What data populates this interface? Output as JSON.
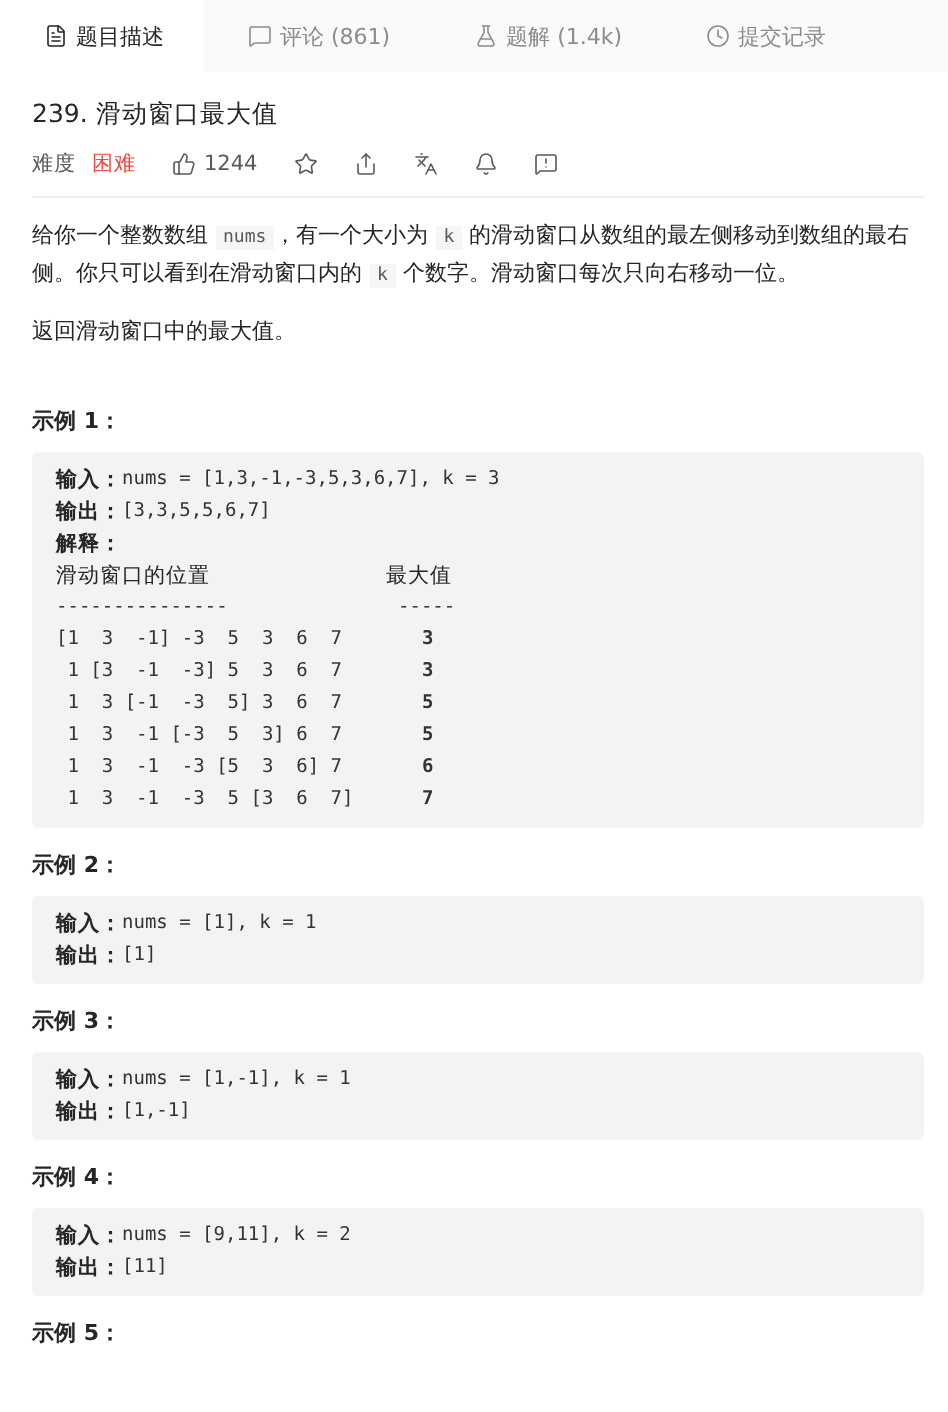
{
  "tabs": [
    {
      "kind": "description",
      "label": "题目描述",
      "selected": true
    },
    {
      "kind": "comments",
      "label": "评论 (861)",
      "selected": false
    },
    {
      "kind": "solutions",
      "label": "题解 (1.4k)",
      "selected": false
    },
    {
      "kind": "submissions",
      "label": "提交记录",
      "selected": false
    }
  ],
  "problem": {
    "title": "239. 滑动窗口最大值",
    "difficulty_label": "难度",
    "difficulty": "困难",
    "likes": "1244"
  },
  "description": [
    [
      {
        "kind": "text",
        "text": "给你一个整数数组 "
      },
      {
        "kind": "code",
        "text": "nums"
      },
      {
        "kind": "text",
        "text": "，有一个大小为 "
      },
      {
        "kind": "code",
        "text": "k"
      },
      {
        "kind": "text",
        "text": " 的滑动窗口从数组的最左侧移动到数组的最右侧。你只可以看到在滑动窗口内的 "
      },
      {
        "kind": "code",
        "text": "k"
      },
      {
        "kind": "text",
        "text": " 个数字。滑动窗口每次只向右移动一位。"
      }
    ],
    [
      {
        "kind": "text",
        "text": "返回滑动窗口中的最大值。"
      }
    ]
  ],
  "examples": [
    {
      "heading": "示例 1：",
      "lines": [
        {
          "label": "输入：",
          "value": "nums = [1,3,-1,-3,5,3,6,7], k = 3"
        },
        {
          "label": "输出：",
          "value": "[3,3,5,5,6,7]"
        }
      ],
      "explanation": {
        "label": "解释：",
        "header": [
          "滑动窗口的位置",
          "最大值"
        ],
        "rule": [
          "---------------",
          "-----"
        ],
        "rows": [
          {
            "window": "[1  3  -1] -3  5  3  6  7",
            "max": "3"
          },
          {
            "window": " 1 [3  -1  -3] 5  3  6  7",
            "max": "3"
          },
          {
            "window": " 1  3 [-1  -3  5] 3  6  7",
            "max": "5"
          },
          {
            "window": " 1  3  -1 [-3  5  3] 6  7",
            "max": "5"
          },
          {
            "window": " 1  3  -1  -3 [5  3  6] 7",
            "max": "6"
          },
          {
            "window": " 1  3  -1  -3  5 [3  6  7]",
            "max": "7"
          }
        ]
      }
    },
    {
      "heading": "示例 2：",
      "lines": [
        {
          "label": "输入：",
          "value": "nums = [1], k = 1"
        },
        {
          "label": "输出：",
          "value": "[1]"
        }
      ]
    },
    {
      "heading": "示例 3：",
      "lines": [
        {
          "label": "输入：",
          "value": "nums = [1,-1], k = 1"
        },
        {
          "label": "输出：",
          "value": "[1,-1]"
        }
      ]
    },
    {
      "heading": "示例 4：",
      "lines": [
        {
          "label": "输入：",
          "value": "nums = [9,11], k = 2"
        },
        {
          "label": "输出：",
          "value": "[11]"
        }
      ]
    },
    {
      "heading": "示例 5："
    }
  ]
}
